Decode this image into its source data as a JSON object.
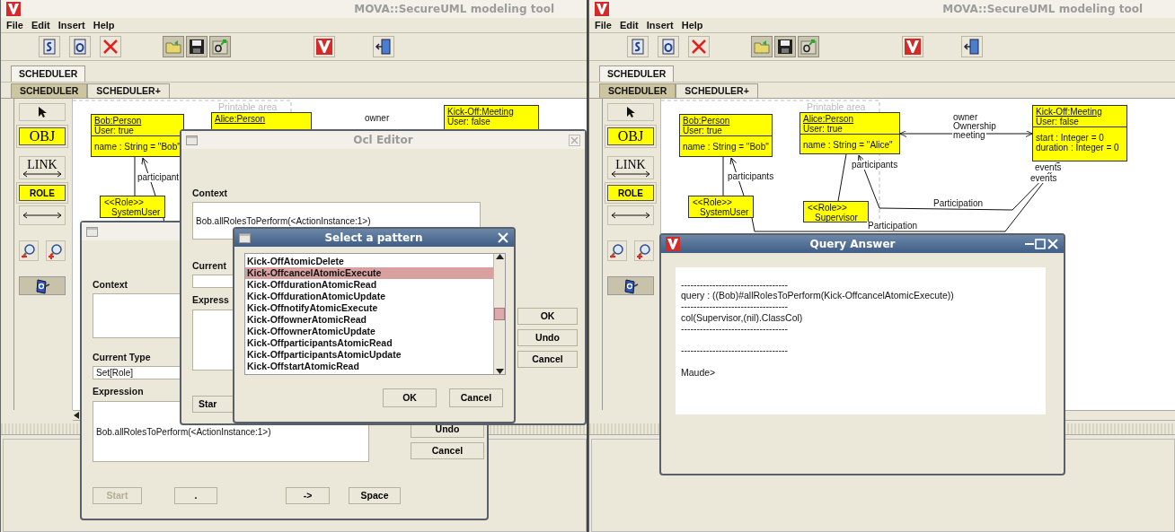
{
  "screens": [
    {
      "title": "MOVA::SecureUML modeling tool",
      "menu": [
        "File",
        "Edit",
        "Insert",
        "Help"
      ],
      "tabs": [
        {
          "label": "SCHEDULER",
          "selected": true
        }
      ],
      "subtabs": [
        {
          "label": "SCHEDULER",
          "selected": true
        },
        {
          "label": "SCHEDULER+",
          "selected": false
        }
      ],
      "tools": [
        {
          "kind": "pointer",
          "selected": false
        },
        {
          "kind": "object",
          "label": "OBJ",
          "selected": false
        },
        {
          "kind": "link",
          "label": "LINK",
          "selected": false
        },
        {
          "kind": "role",
          "label": "ROLE",
          "selected": false
        },
        {
          "kind": "association",
          "selected": false
        },
        {
          "kind": "zoom_out",
          "selected": false
        },
        {
          "kind": "zoom_in",
          "selected": false
        },
        {
          "kind": "query",
          "selected": true
        }
      ],
      "diagram": {
        "printable_area": "Printable area",
        "objects": [
          {
            "name": "Bob:Person",
            "user": "User: true",
            "attributes": [
              "name : String = \"Bob\""
            ]
          },
          {
            "name": "Alice:Person"
          },
          {
            "name": "Kick-Off:Meeting",
            "user": "User: false"
          }
        ],
        "roles": [
          {
            "stereotype": "<<Role>>",
            "name": "SystemUser"
          }
        ],
        "labels": [
          "owner",
          "participant"
        ]
      },
      "dialogs": [
        {
          "kind": "expression_editor",
          "context_label": "Context",
          "type_label": "Current Type",
          "type": "Set[Role]",
          "expression_label": "Expression",
          "expression": "Bob.allRolesToPerform(<ActionInstance:1>)",
          "side_buttons": [
            "Undo",
            "Cancel"
          ],
          "bottom_buttons": [
            {
              "label": "Start",
              "disabled": true
            },
            {
              "label": ".",
              "disabled": false
            },
            {
              "label": "->",
              "disabled": false
            },
            {
              "label": "Space",
              "disabled": false
            }
          ]
        },
        {
          "kind": "ocl_editor",
          "title": "Ocl Editor",
          "context_label": "Context",
          "context": "Bob.allRolesToPerform(<ActionInstance:1>)",
          "type_label": "Current",
          "expression_label": "Express",
          "side_buttons": [
            "OK",
            "Undo",
            "Cancel"
          ],
          "bottom_buttons": [
            {
              "label": "Star",
              "disabled": false
            }
          ]
        },
        {
          "kind": "pattern_select",
          "title": "Select a pattern",
          "items": [
            {
              "label": "Kick-OffAtomicDelete",
              "selected": false
            },
            {
              "label": "Kick-OffcancelAtomicExecute",
              "selected": true
            },
            {
              "label": "Kick-OffdurationAtomicRead",
              "selected": false
            },
            {
              "label": "Kick-OffdurationAtomicUpdate",
              "selected": false
            },
            {
              "label": "Kick-OffnotifyAtomicExecute",
              "selected": false
            },
            {
              "label": "Kick-OffownerAtomicRead",
              "selected": false
            },
            {
              "label": "Kick-OffownerAtomicUpdate",
              "selected": false
            },
            {
              "label": "Kick-OffparticipantsAtomicRead",
              "selected": false
            },
            {
              "label": "Kick-OffparticipantsAtomicUpdate",
              "selected": false
            },
            {
              "label": "Kick-OffstartAtomicRead",
              "selected": false
            }
          ],
          "buttons": [
            "OK",
            "Cancel"
          ]
        }
      ]
    },
    {
      "title": "MOVA::SecureUML modeling tool",
      "menu": [
        "File",
        "Edit",
        "Insert",
        "Help"
      ],
      "tabs": [
        {
          "label": "SCHEDULER",
          "selected": true
        }
      ],
      "subtabs": [
        {
          "label": "SCHEDULER",
          "selected": true
        },
        {
          "label": "SCHEDULER+",
          "selected": false
        }
      ],
      "tools": [
        {
          "kind": "pointer",
          "selected": false
        },
        {
          "kind": "object",
          "label": "OBJ",
          "selected": false
        },
        {
          "kind": "link",
          "label": "LINK",
          "selected": false
        },
        {
          "kind": "role",
          "label": "ROLE",
          "selected": false
        },
        {
          "kind": "association",
          "selected": false
        },
        {
          "kind": "zoom_out",
          "selected": false
        },
        {
          "kind": "zoom_in",
          "selected": false
        },
        {
          "kind": "query",
          "selected": true
        }
      ],
      "diagram": {
        "printable_area": "Printable area",
        "objects": [
          {
            "name": "Bob:Person",
            "user": "User: true",
            "attributes": [
              "name : String = \"Bob\""
            ]
          },
          {
            "name": "Alice:Person",
            "user": "User: true",
            "attributes": [
              "name : String = \"Alice\""
            ]
          },
          {
            "name": "Kick-Off:Meeting",
            "user": "User: false",
            "attributes": [
              "start : Integer = 0",
              "duration : Integer = 0"
            ]
          }
        ],
        "roles": [
          {
            "stereotype": "<<Role>>",
            "name": "SystemUser"
          },
          {
            "stereotype": "<<Role>>",
            "name": "Supervisor"
          }
        ],
        "labels": [
          "owner",
          "Ownership",
          "meeting",
          "participants",
          "participants",
          "Participation",
          "Participation",
          "events",
          "events"
        ]
      },
      "dialogs": [
        {
          "kind": "query_answer",
          "title": "Query Answer",
          "output": "----------------------------------\nquery : ((Bob)#allRolesToPerform(Kick-OffcancelAtomicExecute))\n----------------------------------\ncol(Supervisor,(nil).ClassCol)\n----------------------------------\n\n----------------------------------\n\nMaude>"
        }
      ]
    }
  ]
}
